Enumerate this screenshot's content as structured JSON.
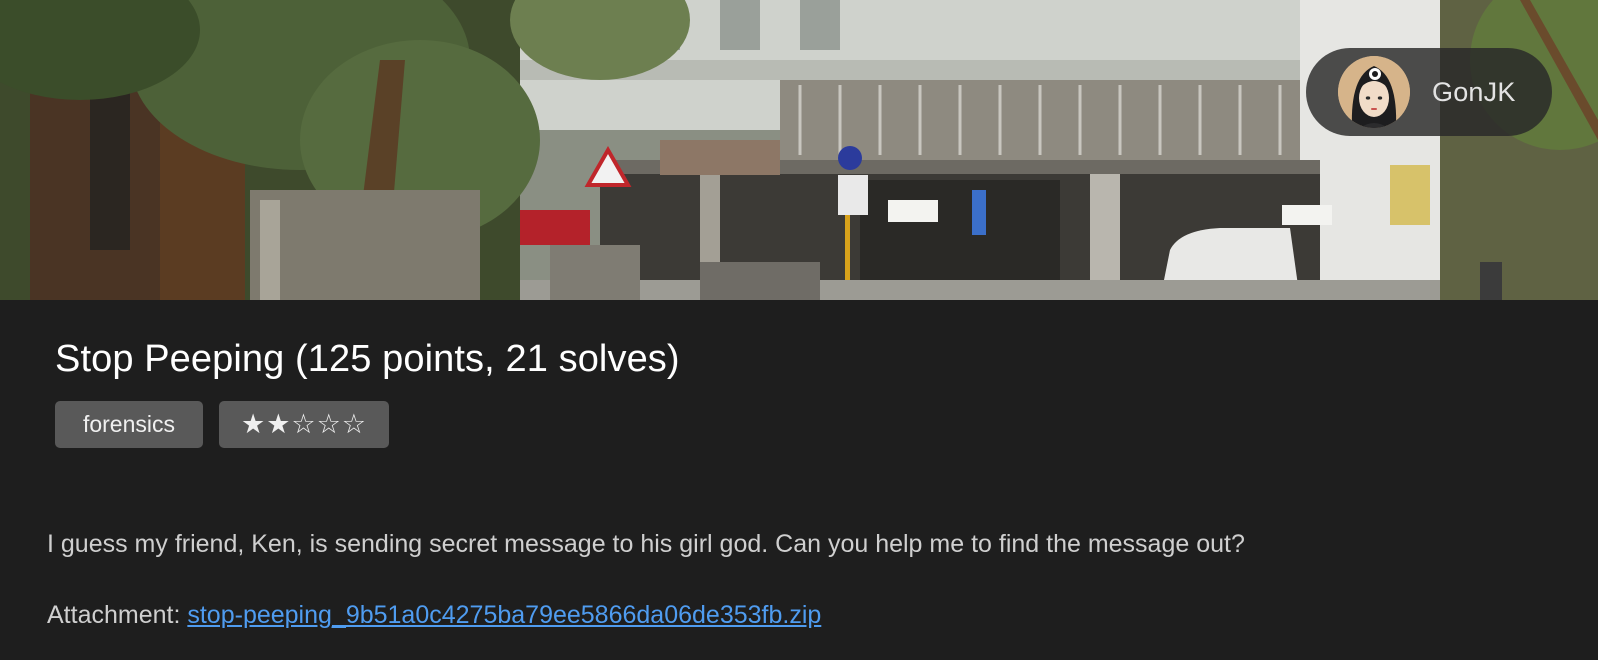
{
  "banner": {
    "image_description_icon": "street-photo",
    "author": {
      "name": "GonJK",
      "avatar_icon": "avatar-girl"
    }
  },
  "challenge": {
    "title": "Stop Peeping (125 points, 21 solves)",
    "category": "forensics",
    "difficulty": "★★☆☆☆",
    "difficulty_value": 2,
    "difficulty_max": 5,
    "description": "I guess my friend, Ken, is sending secret message to his girl god. Can you help me to find the message out?",
    "attachment_label": "Attachment: ",
    "attachment_file": "stop-peeping_9b51a0c4275ba79ee5866da06de353fb.zip"
  },
  "colors": {
    "background": "#1e1e1e",
    "tag_background": "#595959",
    "link": "#4f9cf0",
    "text_muted": "#cfcfcf"
  }
}
